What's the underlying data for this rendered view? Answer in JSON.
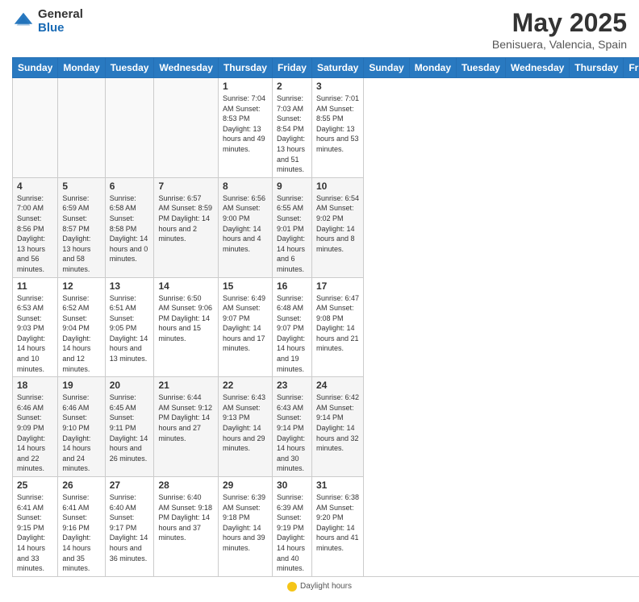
{
  "header": {
    "logo_general": "General",
    "logo_blue": "Blue",
    "title": "May 2025",
    "location": "Benisuera, Valencia, Spain"
  },
  "days_of_week": [
    "Sunday",
    "Monday",
    "Tuesday",
    "Wednesday",
    "Thursday",
    "Friday",
    "Saturday"
  ],
  "weeks": [
    [
      {
        "day": "",
        "info": ""
      },
      {
        "day": "",
        "info": ""
      },
      {
        "day": "",
        "info": ""
      },
      {
        "day": "",
        "info": ""
      },
      {
        "day": "1",
        "info": "Sunrise: 7:04 AM\nSunset: 8:53 PM\nDaylight: 13 hours and 49 minutes."
      },
      {
        "day": "2",
        "info": "Sunrise: 7:03 AM\nSunset: 8:54 PM\nDaylight: 13 hours and 51 minutes."
      },
      {
        "day": "3",
        "info": "Sunrise: 7:01 AM\nSunset: 8:55 PM\nDaylight: 13 hours and 53 minutes."
      }
    ],
    [
      {
        "day": "4",
        "info": "Sunrise: 7:00 AM\nSunset: 8:56 PM\nDaylight: 13 hours and 56 minutes."
      },
      {
        "day": "5",
        "info": "Sunrise: 6:59 AM\nSunset: 8:57 PM\nDaylight: 13 hours and 58 minutes."
      },
      {
        "day": "6",
        "info": "Sunrise: 6:58 AM\nSunset: 8:58 PM\nDaylight: 14 hours and 0 minutes."
      },
      {
        "day": "7",
        "info": "Sunrise: 6:57 AM\nSunset: 8:59 PM\nDaylight: 14 hours and 2 minutes."
      },
      {
        "day": "8",
        "info": "Sunrise: 6:56 AM\nSunset: 9:00 PM\nDaylight: 14 hours and 4 minutes."
      },
      {
        "day": "9",
        "info": "Sunrise: 6:55 AM\nSunset: 9:01 PM\nDaylight: 14 hours and 6 minutes."
      },
      {
        "day": "10",
        "info": "Sunrise: 6:54 AM\nSunset: 9:02 PM\nDaylight: 14 hours and 8 minutes."
      }
    ],
    [
      {
        "day": "11",
        "info": "Sunrise: 6:53 AM\nSunset: 9:03 PM\nDaylight: 14 hours and 10 minutes."
      },
      {
        "day": "12",
        "info": "Sunrise: 6:52 AM\nSunset: 9:04 PM\nDaylight: 14 hours and 12 minutes."
      },
      {
        "day": "13",
        "info": "Sunrise: 6:51 AM\nSunset: 9:05 PM\nDaylight: 14 hours and 13 minutes."
      },
      {
        "day": "14",
        "info": "Sunrise: 6:50 AM\nSunset: 9:06 PM\nDaylight: 14 hours and 15 minutes."
      },
      {
        "day": "15",
        "info": "Sunrise: 6:49 AM\nSunset: 9:07 PM\nDaylight: 14 hours and 17 minutes."
      },
      {
        "day": "16",
        "info": "Sunrise: 6:48 AM\nSunset: 9:07 PM\nDaylight: 14 hours and 19 minutes."
      },
      {
        "day": "17",
        "info": "Sunrise: 6:47 AM\nSunset: 9:08 PM\nDaylight: 14 hours and 21 minutes."
      }
    ],
    [
      {
        "day": "18",
        "info": "Sunrise: 6:46 AM\nSunset: 9:09 PM\nDaylight: 14 hours and 22 minutes."
      },
      {
        "day": "19",
        "info": "Sunrise: 6:46 AM\nSunset: 9:10 PM\nDaylight: 14 hours and 24 minutes."
      },
      {
        "day": "20",
        "info": "Sunrise: 6:45 AM\nSunset: 9:11 PM\nDaylight: 14 hours and 26 minutes."
      },
      {
        "day": "21",
        "info": "Sunrise: 6:44 AM\nSunset: 9:12 PM\nDaylight: 14 hours and 27 minutes."
      },
      {
        "day": "22",
        "info": "Sunrise: 6:43 AM\nSunset: 9:13 PM\nDaylight: 14 hours and 29 minutes."
      },
      {
        "day": "23",
        "info": "Sunrise: 6:43 AM\nSunset: 9:14 PM\nDaylight: 14 hours and 30 minutes."
      },
      {
        "day": "24",
        "info": "Sunrise: 6:42 AM\nSunset: 9:14 PM\nDaylight: 14 hours and 32 minutes."
      }
    ],
    [
      {
        "day": "25",
        "info": "Sunrise: 6:41 AM\nSunset: 9:15 PM\nDaylight: 14 hours and 33 minutes."
      },
      {
        "day": "26",
        "info": "Sunrise: 6:41 AM\nSunset: 9:16 PM\nDaylight: 14 hours and 35 minutes."
      },
      {
        "day": "27",
        "info": "Sunrise: 6:40 AM\nSunset: 9:17 PM\nDaylight: 14 hours and 36 minutes."
      },
      {
        "day": "28",
        "info": "Sunrise: 6:40 AM\nSunset: 9:18 PM\nDaylight: 14 hours and 37 minutes."
      },
      {
        "day": "29",
        "info": "Sunrise: 6:39 AM\nSunset: 9:18 PM\nDaylight: 14 hours and 39 minutes."
      },
      {
        "day": "30",
        "info": "Sunrise: 6:39 AM\nSunset: 9:19 PM\nDaylight: 14 hours and 40 minutes."
      },
      {
        "day": "31",
        "info": "Sunrise: 6:38 AM\nSunset: 9:20 PM\nDaylight: 14 hours and 41 minutes."
      }
    ]
  ],
  "footer": {
    "daylight_label": "Daylight hours"
  }
}
